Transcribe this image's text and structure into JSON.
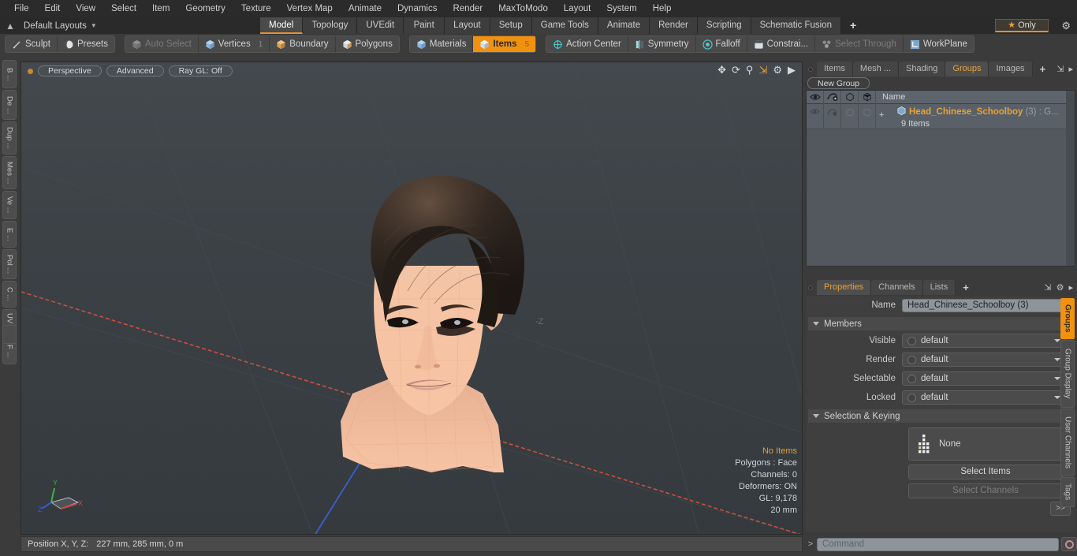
{
  "menubar": {
    "items": [
      "File",
      "Edit",
      "View",
      "Select",
      "Item",
      "Geometry",
      "Texture",
      "Vertex Map",
      "Animate",
      "Dynamics",
      "Render",
      "MaxToModo",
      "Layout",
      "System",
      "Help"
    ]
  },
  "layoutbar": {
    "home_icon": "home-icon",
    "layout_label": "Default Layouts",
    "tabs": [
      {
        "label": "Model",
        "active": true
      },
      {
        "label": "Topology",
        "active": false
      },
      {
        "label": "UVEdit",
        "active": false
      },
      {
        "label": "Paint",
        "active": false
      },
      {
        "label": "Layout",
        "active": false
      },
      {
        "label": "Setup",
        "active": false
      },
      {
        "label": "Game Tools",
        "active": false
      },
      {
        "label": "Animate",
        "active": false
      },
      {
        "label": "Render",
        "active": false
      },
      {
        "label": "Scripting",
        "active": false
      },
      {
        "label": "Schematic Fusion",
        "active": false
      }
    ],
    "add_tab": "+",
    "only_label": "Only",
    "star_glyph": "★",
    "gear_glyph": "⚙"
  },
  "modebar": {
    "group1": [
      {
        "label": "Sculpt",
        "icon": "pen-icon",
        "state": "normal"
      },
      {
        "label": "Presets",
        "icon": "sphere-icon",
        "state": "normal"
      }
    ],
    "group2": [
      {
        "label": "Auto Select",
        "icon": "cube-icon",
        "state": "dim",
        "badge": ""
      },
      {
        "label": "Vertices",
        "icon": "cube-blue-icon",
        "state": "normal",
        "badge": "1"
      },
      {
        "label": "Boundary",
        "icon": "cube-orange-icon",
        "state": "normal",
        "badge": ""
      },
      {
        "label": "Polygons",
        "icon": "cube-tan-icon",
        "state": "normal",
        "badge": ""
      }
    ],
    "group3": [
      {
        "label": "Materials",
        "icon": "cube-blue-icon",
        "state": "normal",
        "badge": ""
      },
      {
        "label": "Items",
        "icon": "cube-icon",
        "state": "active",
        "badge": "5"
      }
    ],
    "group4": [
      {
        "label": "Action Center",
        "icon": "crosshair-icon",
        "state": "normal"
      },
      {
        "label": "Symmetry",
        "icon": "mirror-icon",
        "state": "normal"
      },
      {
        "label": "Falloff",
        "icon": "target-icon",
        "state": "normal"
      },
      {
        "label": "Constrai...",
        "icon": "square-icon",
        "state": "normal"
      },
      {
        "label": "Select Through",
        "icon": "through-icon",
        "state": "dim"
      },
      {
        "label": "WorkPlane",
        "icon": "workplane-icon",
        "state": "normal"
      }
    ]
  },
  "left_rail": {
    "tabs": [
      "B ...",
      "De ...",
      "Dup ...",
      "Mes ...",
      "Ve ...",
      "E ...",
      "Pol ...",
      "C ...",
      "UV ...",
      "F ..."
    ]
  },
  "viewport": {
    "pills": [
      "Perspective",
      "Advanced",
      "Ray GL: Off"
    ],
    "nav_icons": [
      "move-icon",
      "rotate-icon",
      "magnify-icon",
      "maximize-icon",
      "gear-icon",
      "play-arrow-icon"
    ],
    "stats": {
      "selection": "No Items",
      "polygons": "Polygons : Face",
      "channels": "Channels: 0",
      "deformers": "Deformers: ON",
      "gl": "GL: 9,178",
      "scale": "20 mm"
    },
    "axis_labels": {
      "x": "X",
      "y": "Y",
      "z": "Z"
    },
    "axis_colors": {
      "x": "#d04545",
      "y": "#3fb44a",
      "z": "#3558d8"
    },
    "z_label": "-Z"
  },
  "items_panel": {
    "tabs": [
      {
        "label": "Items",
        "active": false
      },
      {
        "label": "Mesh ...",
        "active": false
      },
      {
        "label": "Shading",
        "active": false
      },
      {
        "label": "Groups",
        "active": true
      },
      {
        "label": "Images",
        "active": false
      }
    ],
    "add_tab": "+",
    "header_icons": [
      "expand-icon",
      "chevron-right-icon"
    ],
    "new_group_button": "New Group",
    "columns": [
      "eye-icon",
      "render-icon",
      "shade-icon",
      "wire-icon",
      "Name"
    ],
    "rows": [
      {
        "expander": "+",
        "name": "Head_Chinese_Schoolboy",
        "suffix": "(3) : G...",
        "count": "9 Items"
      }
    ]
  },
  "properties_panel": {
    "tabs": [
      {
        "label": "Properties",
        "active": true
      },
      {
        "label": "Channels",
        "active": false
      },
      {
        "label": "Lists",
        "active": false
      }
    ],
    "add_tab": "+",
    "header_icons": [
      "expand-icon",
      "gear-icon",
      "chevron-right-icon"
    ],
    "name_label": "Name",
    "name_value": "Head_Chinese_Schoolboy (3)",
    "members_section": "Members",
    "members": [
      {
        "label": "Visible",
        "value": "default"
      },
      {
        "label": "Render",
        "value": "default"
      },
      {
        "label": "Selectable",
        "value": "default"
      },
      {
        "label": "Locked",
        "value": "default"
      }
    ],
    "selection_section": "Selection & Keying",
    "selection_value": "None",
    "select_items_button": "Select Items",
    "select_channels_button": "Select Channels",
    "expand_button": ">>"
  },
  "right_rail": {
    "tabs": [
      {
        "label": "Groups",
        "active": true
      },
      {
        "label": "Group Display",
        "active": false
      },
      {
        "label": "User Channels",
        "active": false
      },
      {
        "label": "Tags",
        "active": false
      }
    ]
  },
  "statusbar": {
    "position_label": "Position X, Y, Z:",
    "position_value": "227 mm, 285 mm, 0 m"
  },
  "command": {
    "prompt": ">",
    "placeholder": "Command",
    "record_icon": "record-circle-icon"
  },
  "colors": {
    "accent": "#f0920f",
    "accent_text": "#e8a33c",
    "panel": "#3b3b3b",
    "list_bg": "#53585e",
    "field": "#8e9499"
  }
}
